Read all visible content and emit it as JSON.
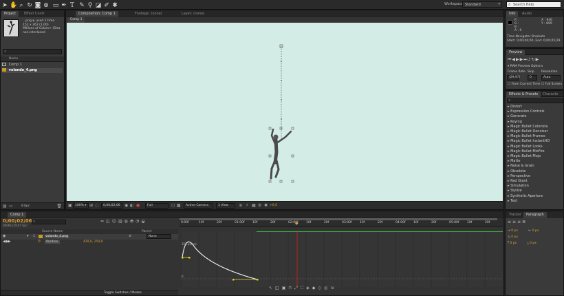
{
  "toolbar": {
    "workspace_label": "Workspace:",
    "workspace_value": "Standard",
    "search_placeholder": "Search Help"
  },
  "project_panel": {
    "tabs": [
      "Project",
      "Effect Contr"
    ],
    "file_name": "...png ▾, used 1 time",
    "file_dims": "152 x 262 (1,00)",
    "file_colors": "Millions of Colors+ (Stra",
    "file_interlace": "non-interlaced",
    "search_placeholder": "",
    "column_name": "Name",
    "items": [
      "Comp 1",
      "volando_4.png"
    ],
    "bpc": "8 bpc"
  },
  "composition_panel": {
    "tabs": [
      "Composition: Comp 1",
      "Footage: (none)",
      "Layer: (none)"
    ],
    "breadcrumb": "Comp 1",
    "zoom": "100%",
    "timecode": "0;00;02;06",
    "resolution": "Full",
    "camera": "Active Camera",
    "views": "1 View",
    "exposure": "+0,0",
    "bg_color": "#d3ece6"
  },
  "info_panel": {
    "tabs": [
      "Info",
      "Audio"
    ],
    "values": [
      "R :",
      "G :",
      "B :",
      "A : 0"
    ],
    "coords": [
      "X : 946",
      "Y : 899"
    ],
    "line1": "Time Navigator Brackets",
    "line2": "Start: 0;00;00;00, End: 0;00;05;29"
  },
  "preview_panel": {
    "tab": "Preview",
    "ram_options": "RAM Preview Options",
    "col_frame_rate": "Frame Rate",
    "col_skip": "Skip",
    "col_resolution": "Resolution",
    "frame_rate_value": "(29,97)",
    "skip_value": "0",
    "resolution_value": "Auto",
    "from_current": "From Current Time",
    "full_screen": "Full Screen"
  },
  "effects_panel": {
    "tabs": [
      "Effects & Presets",
      "Characte"
    ],
    "items": [
      "Distort",
      "Expression Controls",
      "Generate",
      "Keying",
      "Magic Bullet Colorista",
      "Magic Bullet Denoiser",
      "Magic Bullet Frames",
      "Magic Bullet InstantHD",
      "Magic Bullet Looks",
      "Magic Bullet MisFire",
      "Magic Bullet Mojo",
      "Matte",
      "Noise & Grain",
      "Obsolete",
      "Perspective",
      "Red Giant",
      "Simulation",
      "Stylize",
      "Synthetic Aperture",
      "Text"
    ]
  },
  "paragraph_panel": {
    "tabs": [
      "Tracker",
      "Paragraph"
    ],
    "fields": [
      "0 px",
      "0 px",
      "0 px",
      "0 px",
      "0 px"
    ]
  },
  "timeline": {
    "tab": "Comp 1",
    "timecode": "0;00;02;06",
    "fps": "00066 (29,97 fps)",
    "col_source": "Source Name",
    "col_parent": "Parent",
    "layer_number": "1",
    "layer_name": "volando_4.png",
    "parent_value": "None",
    "property_name": "Position",
    "property_value": "429,0, 254,0",
    "ruler": [
      "0:00f",
      "10f",
      "20f",
      "01:00f",
      "10f",
      "20f",
      "02:00f",
      "10f",
      "20f",
      "03:00f",
      "10f",
      "20f",
      "04:00f",
      "10f",
      "20f",
      "05:00f",
      "10f",
      "20f"
    ],
    "speed_label": "358 px/sec",
    "zero_label": "0",
    "toggle_label": "Toggle Switches / Modes"
  }
}
